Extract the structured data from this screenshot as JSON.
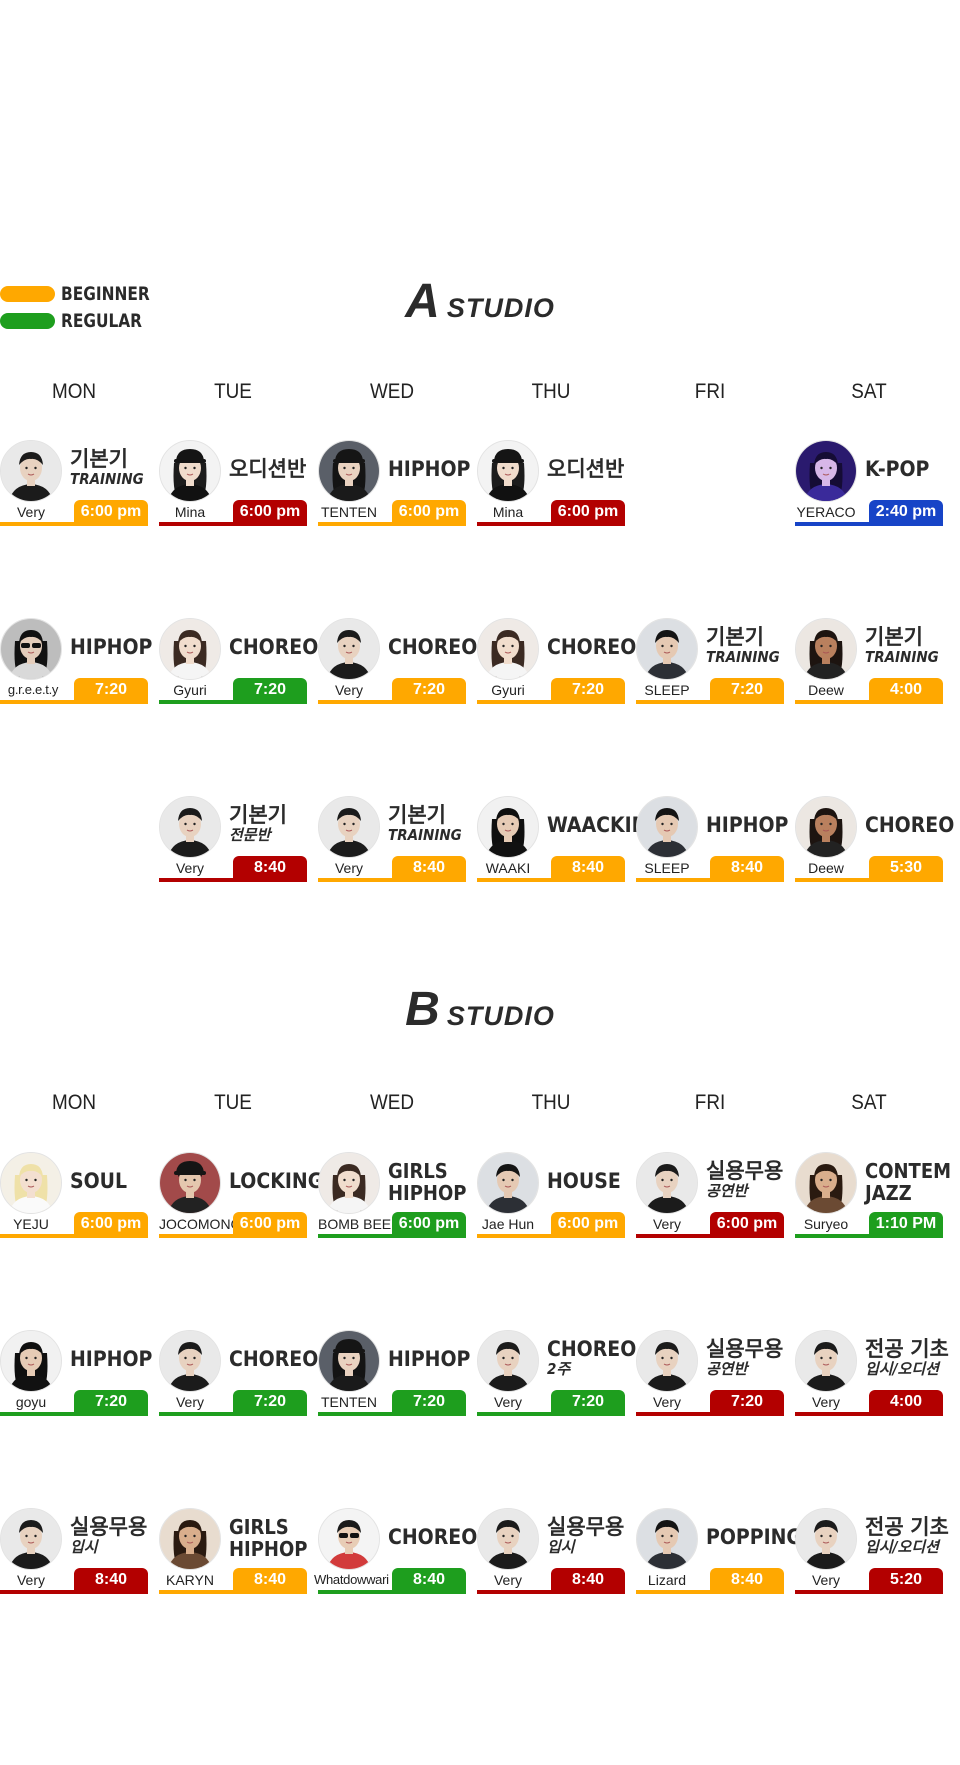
{
  "legend": [
    {
      "label": "BEGINNER",
      "color": "#FFA800"
    },
    {
      "label": "REGULAR",
      "color": "#1E9E1E"
    }
  ],
  "colors": {
    "beginner": "#FFA800",
    "regular": "#1E9E1E",
    "audition": "#B30000",
    "kpop": "#1744C7"
  },
  "days": [
    "MON",
    "TUE",
    "WED",
    "THU",
    "FRI",
    "SAT"
  ],
  "studios": [
    {
      "letter": "A",
      "word": "STUDIO",
      "rows": [
        [
          {
            "line1": "기본기",
            "line2": "TRAINING",
            "style": "sub",
            "teacher": "Very",
            "time": "6:00 pm",
            "level": "beginner",
            "face": "man-short"
          },
          {
            "line1": "오디션반",
            "line2": "",
            "style": "one",
            "teacher": "Mina",
            "time": "6:00 pm",
            "level": "audition",
            "face": "woman-cap"
          },
          {
            "line1": "HIPHOP",
            "line2": "",
            "style": "one",
            "teacher": "TENTEN",
            "time": "6:00 pm",
            "level": "beginner",
            "face": "woman-cap-dark"
          },
          {
            "line1": "오디션반",
            "line2": "",
            "style": "one",
            "teacher": "Mina",
            "time": "6:00 pm",
            "level": "audition",
            "face": "woman-cap"
          },
          null,
          {
            "line1": "K-POP",
            "line2": "",
            "style": "one",
            "teacher": "YERACO",
            "time": "2:40 pm",
            "level": "kpop",
            "face": "woman-purple"
          }
        ],
        [
          {
            "line1": "HIPHOP",
            "line2": "",
            "style": "one",
            "teacher": "g.r.e.e.t.y",
            "time": "7:20",
            "level": "beginner",
            "face": "woman-glasses"
          },
          {
            "line1": "CHOREO",
            "line2": "",
            "style": "one",
            "teacher": "Gyuri",
            "time": "7:20",
            "level": "regular",
            "face": "woman-long"
          },
          {
            "line1": "CHOREO",
            "line2": "",
            "style": "one",
            "teacher": "Very",
            "time": "7:20",
            "level": "beginner",
            "face": "man-short"
          },
          {
            "line1": "CHOREO",
            "line2": "",
            "style": "one",
            "teacher": "Gyuri",
            "time": "7:20",
            "level": "beginner",
            "face": "woman-long"
          },
          {
            "line1": "기본기",
            "line2": "TRAINING",
            "style": "sub",
            "teacher": "SLEEP",
            "time": "7:20",
            "level": "beginner",
            "face": "man-dark"
          },
          {
            "line1": "기본기",
            "line2": "TRAINING",
            "style": "sub",
            "teacher": "Deew",
            "time": "4:00",
            "level": "beginner",
            "face": "woman-braids"
          }
        ],
        [
          null,
          {
            "line1": "기본기",
            "line2": "전문반",
            "style": "sub",
            "teacher": "Very",
            "time": "8:40",
            "level": "audition",
            "face": "man-short"
          },
          {
            "line1": "기본기",
            "line2": "TRAINING",
            "style": "sub",
            "teacher": "Very",
            "time": "8:40",
            "level": "beginner",
            "face": "man-short"
          },
          {
            "line1": "WAACKING",
            "line2": "",
            "style": "one",
            "teacher": "WAAKI",
            "time": "8:40",
            "level": "beginner",
            "face": "woman-dark"
          },
          {
            "line1": "HIPHOP",
            "line2": "",
            "style": "one",
            "teacher": "SLEEP",
            "time": "8:40",
            "level": "beginner",
            "face": "man-dark"
          },
          {
            "line1": "CHOREO",
            "line2": "",
            "style": "one",
            "teacher": "Deew",
            "time": "5:30",
            "level": "beginner",
            "face": "woman-braids"
          }
        ]
      ]
    },
    {
      "letter": "B",
      "word": "STUDIO",
      "rows": [
        [
          {
            "line1": "SOUL",
            "line2": "",
            "style": "one",
            "teacher": "YEJU",
            "time": "6:00 pm",
            "level": "beginner",
            "face": "woman-blonde"
          },
          {
            "line1": "LOCKING",
            "line2": "",
            "style": "one",
            "teacher": "JOCOMONG",
            "time": "6:00 pm",
            "level": "beginner",
            "face": "man-cap"
          },
          {
            "line1": "GIRLS",
            "line2": "HIPHOP",
            "style": "two",
            "teacher": "BOMB BEE",
            "time": "6:00 pm",
            "level": "regular",
            "face": "woman-long"
          },
          {
            "line1": "HOUSE",
            "line2": "",
            "style": "one",
            "teacher": "Jae Hun",
            "time": "6:00 pm",
            "level": "beginner",
            "face": "man-dark"
          },
          {
            "line1": "실용무용",
            "line2": "공연반",
            "style": "sub",
            "teacher": "Very",
            "time": "6:00 pm",
            "level": "audition",
            "face": "man-short"
          },
          {
            "line1": "CONTEM",
            "line2": "JAZZ",
            "style": "two",
            "teacher": "Suryeo",
            "time": "1:10 PM",
            "level": "regular",
            "face": "woman-tan"
          }
        ],
        [
          {
            "line1": "HIPHOP",
            "line2": "",
            "style": "one",
            "teacher": "goyu",
            "time": "7:20",
            "level": "regular",
            "face": "woman-dark"
          },
          {
            "line1": "CHOREO",
            "line2": "",
            "style": "one",
            "teacher": "Very",
            "time": "7:20",
            "level": "regular",
            "face": "man-short"
          },
          {
            "line1": "HIPHOP",
            "line2": "",
            "style": "one",
            "teacher": "TENTEN",
            "time": "7:20",
            "level": "regular",
            "face": "woman-cap-dark"
          },
          {
            "line1": "CHOREO",
            "line2": "2주",
            "style": "sub",
            "teacher": "Very",
            "time": "7:20",
            "level": "regular",
            "face": "man-short"
          },
          {
            "line1": "실용무용",
            "line2": "공연반",
            "style": "sub",
            "teacher": "Very",
            "time": "7:20",
            "level": "audition",
            "face": "man-short"
          },
          {
            "line1": "전공 기초",
            "line2": "입시/오디션",
            "style": "sub",
            "teacher": "Very",
            "time": "4:00",
            "level": "audition",
            "face": "man-short"
          }
        ],
        [
          {
            "line1": "실용무용",
            "line2": "입시",
            "style": "sub",
            "teacher": "Very",
            "time": "8:40",
            "level": "audition",
            "face": "man-short"
          },
          {
            "line1": "GIRLS",
            "line2": "HIPHOP",
            "style": "two",
            "teacher": "KARYN",
            "time": "8:40",
            "level": "beginner",
            "face": "woman-tan"
          },
          {
            "line1": "CHOREO",
            "line2": "",
            "style": "one",
            "teacher": "Whatdowwari",
            "time": "8:40",
            "level": "regular",
            "face": "woman-sunglasses"
          },
          {
            "line1": "실용무용",
            "line2": "입시",
            "style": "sub",
            "teacher": "Very",
            "time": "8:40",
            "level": "audition",
            "face": "man-short"
          },
          {
            "line1": "POPPING",
            "line2": "",
            "style": "one",
            "teacher": "Lizard",
            "time": "8:40",
            "level": "beginner",
            "face": "man-dark"
          },
          {
            "line1": "전공 기초",
            "line2": "입시/오디션",
            "style": "sub",
            "teacher": "Very",
            "time": "5:20",
            "level": "audition",
            "face": "man-short"
          }
        ]
      ]
    }
  ]
}
